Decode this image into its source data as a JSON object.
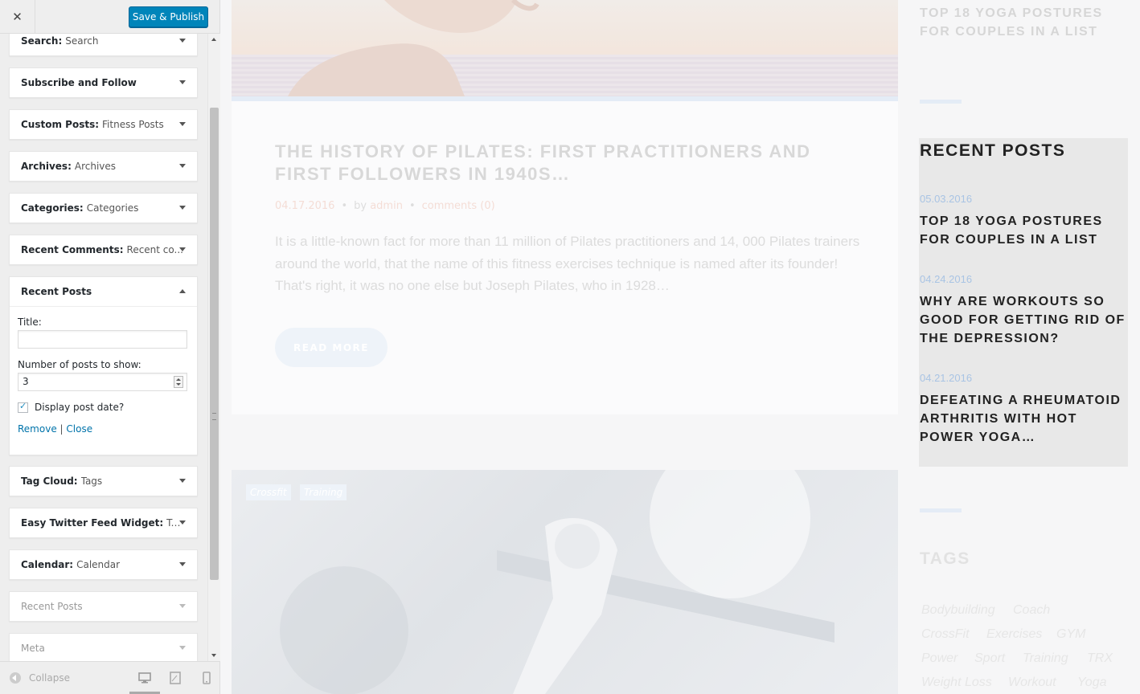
{
  "customizer": {
    "close_label": "✕",
    "save_label": "Save & Publish",
    "widgets": [
      {
        "title": "Search:",
        "subtitle": "Search"
      },
      {
        "title": "Subscribe and Follow",
        "subtitle": ""
      },
      {
        "title": "Custom Posts:",
        "subtitle": "Fitness Posts"
      },
      {
        "title": "Archives:",
        "subtitle": "Archives"
      },
      {
        "title": "Categories:",
        "subtitle": "Categories"
      },
      {
        "title": "Recent Comments:",
        "subtitle": "Recent co..."
      },
      {
        "title": "Recent Posts",
        "subtitle": ""
      },
      {
        "title": "Tag Cloud:",
        "subtitle": "Tags"
      },
      {
        "title": "Easy Twitter Feed Widget:",
        "subtitle": "Twi..."
      },
      {
        "title": "Calendar:",
        "subtitle": "Calendar"
      },
      {
        "title": "Recent Posts",
        "subtitle": ""
      },
      {
        "title": "Meta",
        "subtitle": ""
      }
    ],
    "expanded_form": {
      "title_label": "Title:",
      "title_value": "",
      "count_label": "Number of posts to show:",
      "count_value": "3",
      "show_date_label": "Display post date?",
      "show_date_checked": true,
      "remove_label": "Remove",
      "separator": "|",
      "close_label": "Close"
    },
    "footer": {
      "collapse_label": "Collapse"
    }
  },
  "preview": {
    "top_sidebar_title": "TOP 18 YOGA POSTURES FOR COUPLES IN A LIST",
    "post": {
      "title": "THE HISTORY OF PILATES: FIRST PRACTITIONERS AND FIRST FOLLOWERS IN 1940S…",
      "date": "04.17.2016",
      "by": "by",
      "author": "admin",
      "comments": "comments (0)",
      "excerpt": "It is a little-known fact for more than 11 million of Pilates practitioners and 14, 000 Pilates trainers around the world, that the name of this fitness exercises technique is named after its founder! That's right, it was no one else but Joseph Pilates, who in 1928…",
      "read_more": "READ MORE"
    },
    "second_post_tags": [
      "Crossfit",
      "Training"
    ],
    "recent_posts": {
      "heading": "RECENT POSTS",
      "items": [
        {
          "date": "05.03.2016",
          "title": "TOP 18 YOGA POSTURES FOR COUPLES IN A LIST"
        },
        {
          "date": "04.24.2016",
          "title": "WHY ARE WORKOUTS SO GOOD FOR GETTING RID OF THE DEPRESSION?"
        },
        {
          "date": "04.21.2016",
          "title": "DEFEATING A RHEUMATOID ARTHRITIS WITH HOT POWER YOGA…"
        }
      ]
    },
    "tags_widget": {
      "heading": "TAGS",
      "tags": [
        "Bodybuilding",
        "Coach",
        "CrossFit",
        "Exercises",
        "GYM",
        "Power",
        "Sport",
        "Training",
        "TRX",
        "Weight Loss",
        "Workout",
        "Yoga"
      ]
    }
  },
  "colors": {
    "accent": "#0085ba",
    "link": "#0073aa",
    "date": "#a9c4e4"
  }
}
